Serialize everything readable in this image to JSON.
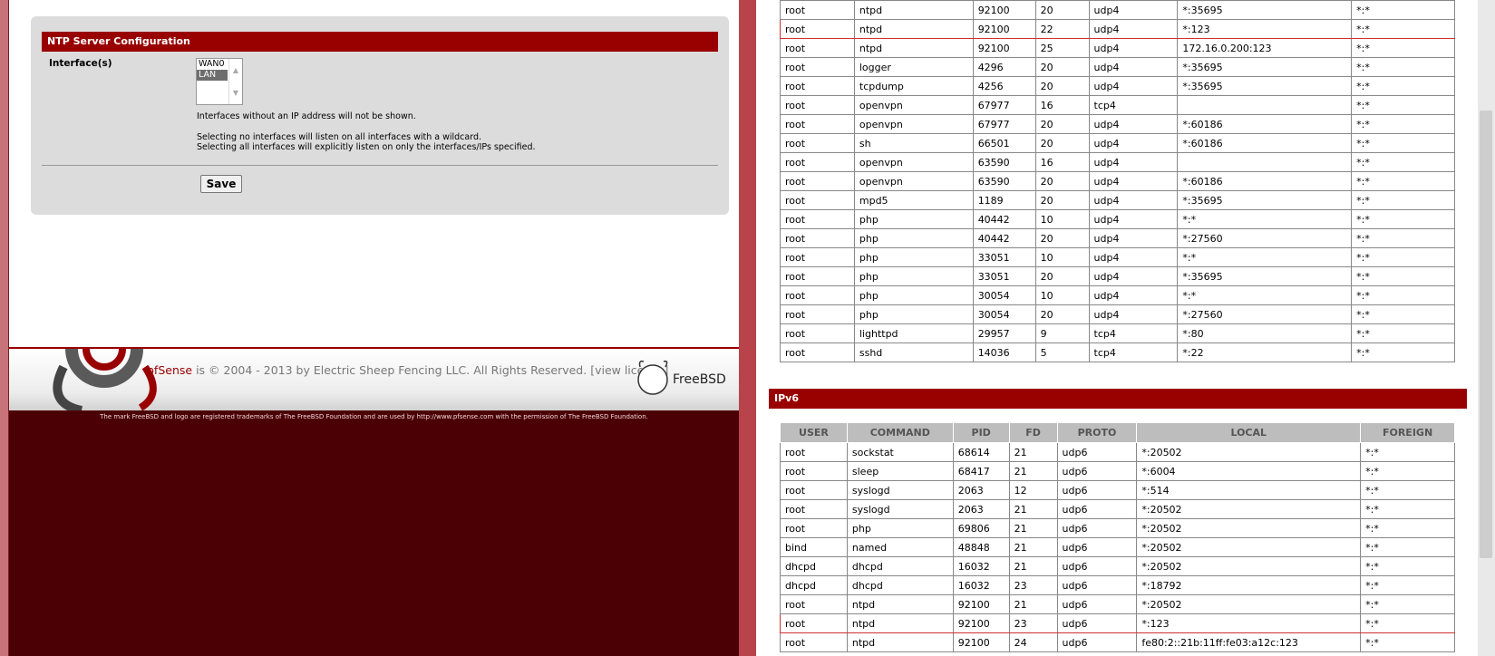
{
  "left": {
    "ntp": {
      "header": "NTP Server Configuration",
      "interfaces_label": "Interface(s)",
      "interface_options": [
        "WAN0",
        "LAN"
      ],
      "selected_option": "LAN",
      "help_line1": "Interfaces without an IP address will not be shown.",
      "help_line2": "Selecting no interfaces will listen on all interfaces with a wildcard.",
      "help_line3": "Selecting all interfaces will explicitly listen on only the interfaces/IPs specified.",
      "save_label": "Save"
    },
    "footer": {
      "brand": "pfSense",
      "copyright": " is © 2004 - 2013 by Electric Sheep Fencing LLC. All Rights Reserved. [view license]",
      "freebsd_label": "FreeBSD",
      "trademark": "The mark FreeBSD and logo are registered trademarks of The FreeBSD Foundation and are used by http://www.pfsense.com with the permission of The FreeBSD Foundation."
    }
  },
  "ipv4": {
    "rows": [
      {
        "user": "root",
        "command": "ntpd",
        "pid": "92100",
        "fd": "20",
        "proto": "udp4",
        "local": "*:35695",
        "foreign": "*:*"
      },
      {
        "user": "root",
        "command": "ntpd",
        "pid": "92100",
        "fd": "22",
        "proto": "udp4",
        "local": "*:123",
        "foreign": "*:*",
        "highlight": true
      },
      {
        "user": "root",
        "command": "ntpd",
        "pid": "92100",
        "fd": "25",
        "proto": "udp4",
        "local": "172.16.0.200:123",
        "foreign": "*:*"
      },
      {
        "user": "root",
        "command": "logger",
        "pid": "4296",
        "fd": "20",
        "proto": "udp4",
        "local": "*:35695",
        "foreign": "*:*"
      },
      {
        "user": "root",
        "command": "tcpdump",
        "pid": "4256",
        "fd": "20",
        "proto": "udp4",
        "local": "*:35695",
        "foreign": "*:*"
      },
      {
        "user": "root",
        "command": "openvpn",
        "pid": "67977",
        "fd": "16",
        "proto": "tcp4",
        "local": "",
        "foreign": "*:*"
      },
      {
        "user": "root",
        "command": "openvpn",
        "pid": "67977",
        "fd": "20",
        "proto": "udp4",
        "local": "*:60186",
        "foreign": "*:*"
      },
      {
        "user": "root",
        "command": "sh",
        "pid": "66501",
        "fd": "20",
        "proto": "udp4",
        "local": "*:60186",
        "foreign": "*:*"
      },
      {
        "user": "root",
        "command": "openvpn",
        "pid": "63590",
        "fd": "16",
        "proto": "udp4",
        "local": "",
        "foreign": "*:*"
      },
      {
        "user": "root",
        "command": "openvpn",
        "pid": "63590",
        "fd": "20",
        "proto": "udp4",
        "local": "*:60186",
        "foreign": "*:*"
      },
      {
        "user": "root",
        "command": "mpd5",
        "pid": "1189",
        "fd": "20",
        "proto": "udp4",
        "local": "*:35695",
        "foreign": "*:*"
      },
      {
        "user": "root",
        "command": "php",
        "pid": "40442",
        "fd": "10",
        "proto": "udp4",
        "local": "*:*",
        "foreign": "*:*"
      },
      {
        "user": "root",
        "command": "php",
        "pid": "40442",
        "fd": "20",
        "proto": "udp4",
        "local": "*:27560",
        "foreign": "*:*"
      },
      {
        "user": "root",
        "command": "php",
        "pid": "33051",
        "fd": "10",
        "proto": "udp4",
        "local": "*:*",
        "foreign": "*:*"
      },
      {
        "user": "root",
        "command": "php",
        "pid": "33051",
        "fd": "20",
        "proto": "udp4",
        "local": "*:35695",
        "foreign": "*:*"
      },
      {
        "user": "root",
        "command": "php",
        "pid": "30054",
        "fd": "10",
        "proto": "udp4",
        "local": "*:*",
        "foreign": "*:*"
      },
      {
        "user": "root",
        "command": "php",
        "pid": "30054",
        "fd": "20",
        "proto": "udp4",
        "local": "*:27560",
        "foreign": "*:*"
      },
      {
        "user": "root",
        "command": "lighttpd",
        "pid": "29957",
        "fd": "9",
        "proto": "tcp4",
        "local": "*:80",
        "foreign": "*:*"
      },
      {
        "user": "root",
        "command": "sshd",
        "pid": "14036",
        "fd": "5",
        "proto": "tcp4",
        "local": "*:22",
        "foreign": "*:*"
      }
    ]
  },
  "ipv6": {
    "title": "IPv6",
    "columns": [
      "USER",
      "COMMAND",
      "PID",
      "FD",
      "PROTO",
      "LOCAL",
      "FOREIGN"
    ],
    "rows": [
      {
        "user": "root",
        "command": "sockstat",
        "pid": "68614",
        "fd": "21",
        "proto": "udp6",
        "local": "*:20502",
        "foreign": "*:*"
      },
      {
        "user": "root",
        "command": "sleep",
        "pid": "68417",
        "fd": "21",
        "proto": "udp6",
        "local": "*:6004",
        "foreign": "*:*"
      },
      {
        "user": "root",
        "command": "syslogd",
        "pid": "2063",
        "fd": "12",
        "proto": "udp6",
        "local": "*:514",
        "foreign": "*:*"
      },
      {
        "user": "root",
        "command": "syslogd",
        "pid": "2063",
        "fd": "21",
        "proto": "udp6",
        "local": "*:20502",
        "foreign": "*:*"
      },
      {
        "user": "root",
        "command": "php",
        "pid": "69806",
        "fd": "21",
        "proto": "udp6",
        "local": "*:20502",
        "foreign": "*:*"
      },
      {
        "user": "bind",
        "command": "named",
        "pid": "48848",
        "fd": "21",
        "proto": "udp6",
        "local": "*:20502",
        "foreign": "*:*"
      },
      {
        "user": "dhcpd",
        "command": "dhcpd",
        "pid": "16032",
        "fd": "21",
        "proto": "udp6",
        "local": "*:20502",
        "foreign": "*:*"
      },
      {
        "user": "dhcpd",
        "command": "dhcpd",
        "pid": "16032",
        "fd": "23",
        "proto": "udp6",
        "local": "*:18792",
        "foreign": "*:*"
      },
      {
        "user": "root",
        "command": "ntpd",
        "pid": "92100",
        "fd": "21",
        "proto": "udp6",
        "local": "*:20502",
        "foreign": "*:*"
      },
      {
        "user": "root",
        "command": "ntpd",
        "pid": "92100",
        "fd": "23",
        "proto": "udp6",
        "local": "*:123",
        "foreign": "*:*",
        "highlight": true
      },
      {
        "user": "root",
        "command": "ntpd",
        "pid": "92100",
        "fd": "24",
        "proto": "udp6",
        "local": "fe80:2::21b:11ff:fe03:a12c:123",
        "foreign": "*:*"
      }
    ]
  },
  "colors": {
    "brand_red": "#990000",
    "frame": "#b8434a",
    "footer_dark": "#4a0005",
    "table_header": "#bdbdbd",
    "highlight_border": "#d03030"
  }
}
